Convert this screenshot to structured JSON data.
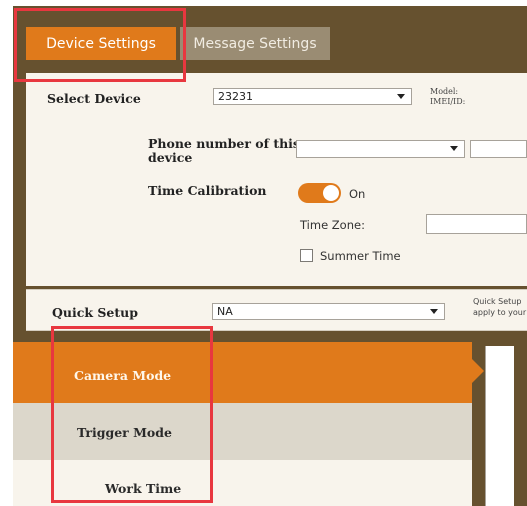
{
  "tabs": [
    {
      "label": "Device Settings",
      "active": true
    },
    {
      "label": "Message Settings",
      "active": false
    }
  ],
  "device": {
    "select_label": "Select Device",
    "select_value": "23231",
    "model_label": "Model:",
    "imei_label": "IMEI/ID:",
    "phone_label_line1": "Phone number of this",
    "phone_label_line2": "device",
    "phone_value": "",
    "time_calibration_label": "Time Calibration",
    "time_calibration_state": "On",
    "time_zone_label": "Time Zone:",
    "summer_time_label": "Summer Time"
  },
  "quick_setup": {
    "label": "Quick Setup",
    "value": "NA",
    "note_line1": "Quick Setup",
    "note_line2": "apply to your"
  },
  "nav": {
    "items": [
      {
        "label": "Camera Mode",
        "selected": true
      },
      {
        "label": "Trigger Mode",
        "selected": false
      },
      {
        "label": "Work Time",
        "selected": false
      }
    ]
  },
  "colors": {
    "accent": "#e07a1b",
    "frame": "#66512f",
    "panel": "#f8f4ec",
    "highlight": "#e8373f"
  }
}
